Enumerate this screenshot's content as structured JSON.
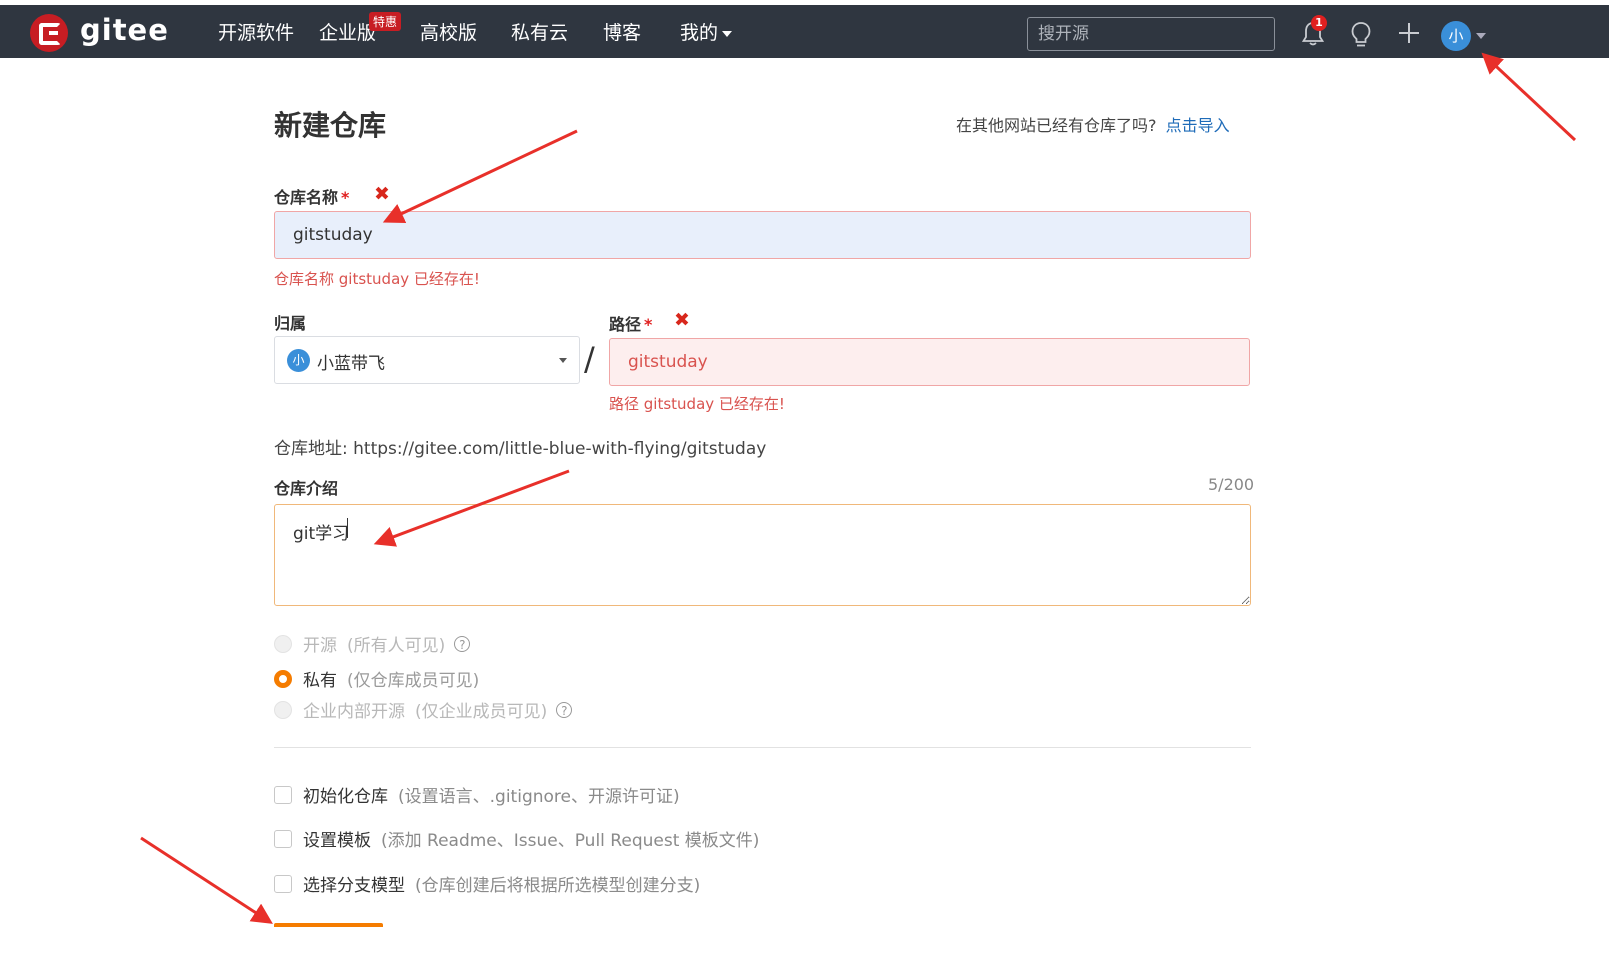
{
  "brand": {
    "name": "gitee"
  },
  "nav": {
    "items": [
      "开源软件",
      "企业版",
      "高校版",
      "私有云",
      "博客",
      "我的"
    ],
    "badge": "特惠",
    "search_placeholder": "搜开源",
    "notification_count": "1",
    "avatar_initial": "小"
  },
  "page": {
    "title": "新建仓库",
    "import_question": "在其他网站已经有仓库了吗?",
    "import_link": "点击导入"
  },
  "form": {
    "name_label": "仓库名称",
    "required_mark": "*",
    "name_value": "gitstuday",
    "name_error": "仓库名称 gitstuday 已经存在!",
    "owner_label": "归属",
    "owner_avatar": "小",
    "owner_value": "小蓝带飞",
    "separator": "/",
    "path_label": "路径",
    "path_value": "gitstuday",
    "path_error": "路径 gitstuday 已经存在!",
    "repo_address": "仓库地址: https://gitee.com/little-blue-with-flying/gitstuday",
    "desc_label": "仓库介绍",
    "desc_counter": "5/200",
    "desc_value": "git学习",
    "visibility": [
      {
        "label": "开源",
        "note": "(所有人可见)",
        "selected": false,
        "disabled": true
      },
      {
        "label": "私有",
        "note": "(仅仓库成员可见)",
        "selected": true,
        "disabled": false
      },
      {
        "label": "企业内部开源",
        "note": "(仅企业成员可见)",
        "selected": false,
        "disabled": true
      }
    ],
    "options": [
      {
        "label": "初始化仓库",
        "note": "(设置语言、.gitignore、开源许可证)",
        "checked": false
      },
      {
        "label": "设置模板",
        "note": "(添加 Readme、Issue、Pull Request 模板文件)",
        "checked": false
      },
      {
        "label": "选择分支模型",
        "note": "(仓库创建后将根据所选模型创建分支)",
        "checked": false
      }
    ]
  },
  "colors": {
    "nav_bg": "#2f3640",
    "brand_red": "#c71d23",
    "accent_orange": "#f57c00",
    "error_red": "#d9534f",
    "link_blue": "#1e6bb8",
    "annotation_red": "#e8302a"
  }
}
